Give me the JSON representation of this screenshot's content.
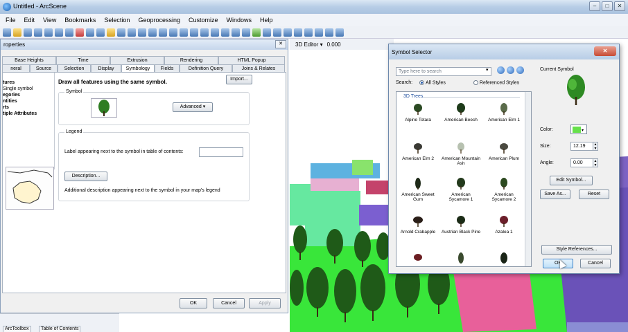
{
  "app": {
    "title": "Untitled - ArcScene",
    "menu": [
      "File",
      "Edit",
      "View",
      "Bookmarks",
      "Selection",
      "Geoprocessing",
      "Customize",
      "Windows",
      "Help"
    ],
    "window_buttons": [
      "–",
      "□",
      "✕"
    ]
  },
  "scene_toolbar": {
    "label": "3D Editor ▾",
    "zvalue": "0.000"
  },
  "properties_dialog": {
    "title": "roperties",
    "tabs_row1": [
      "Base Heights",
      "Time",
      "Extrusion",
      "Rendering",
      "HTML Popup"
    ],
    "tabs_row2": [
      "neral",
      "Source",
      "Selection",
      "Display",
      "Symbology",
      "Fields",
      "Definition Query",
      "Joins & Relates"
    ],
    "active_tab": "Symbology",
    "show_list": [
      "tures",
      "Single symbol",
      "egories",
      "ntities",
      "rts",
      "tiple Attributes"
    ],
    "heading": "Draw all features using the same symbol.",
    "import_label": "Import...",
    "symbol_group": "Symbol",
    "advanced_label": "Advanced",
    "legend_group": "Legend",
    "legend_label_text": "Label appearing next to the symbol in table of contents:",
    "legend_value": "",
    "description_button": "Description...",
    "description_note": "Additional description appearing next to the symbol in your map's legend",
    "ok": "OK",
    "cancel": "Cancel",
    "apply": "Apply"
  },
  "bottom_tabs": [
    "ArcToolbox",
    "Table of Contents"
  ],
  "symbol_selector": {
    "title": "Symbol Selector",
    "close_icon": "close-icon",
    "search_placeholder": "Type here to search",
    "search_label": "Search:",
    "scope_all": "All Styles",
    "scope_referenced": "Referenced Styles",
    "gallery_header": "3D Trees",
    "symbols": [
      "Alpine Totara",
      "American Beech",
      "American Elm 1",
      "American Elm 2",
      "American Mountain Ash",
      "American Plum",
      "American Sweet Gum",
      "American Sycamore 1",
      "American Sycamore 2",
      "Arnold Crabapple",
      "Austrian Black Pine",
      "Azalea 1",
      "",
      "",
      ""
    ],
    "current_symbol_label": "Current Symbol",
    "color_label": "Color:",
    "size_label": "Size:",
    "size_value": "12.19",
    "angle_label": "Angle:",
    "angle_value": "0.00",
    "edit_symbol": "Edit Symbol...",
    "save_as": "Save As...",
    "reset": "Reset",
    "style_references": "Style References...",
    "ok": "OK",
    "cancel": "Cancel"
  },
  "colors": {
    "symbol_color": "#66e04a",
    "accent": "#3c7fc4"
  }
}
